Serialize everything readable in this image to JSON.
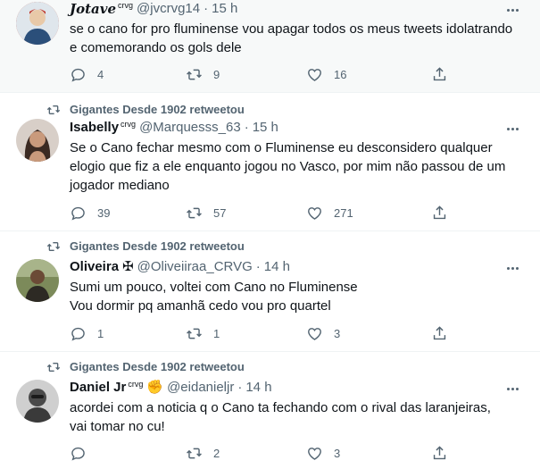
{
  "tweets": [
    {
      "retweeted_by": "",
      "name": "Jotave",
      "name_badge": "crvg",
      "handle": "@jvcrvg14",
      "time": "15 h",
      "text": "se o cano for pro fluminense vou apagar todos os meus tweets idolatrando e comemorando os gols dele",
      "replies": "4",
      "retweets": "9",
      "likes": "16",
      "avatar_colors": [
        "#b33a2c",
        "#e8c9a8"
      ]
    },
    {
      "retweeted_by": "Gigantes Desde 1902 retweetou",
      "name": "Isabelly",
      "name_badge": "crvg",
      "handle": "@Marquesss_63",
      "time": "15 h",
      "text": "Se o Cano fechar mesmo com o Fluminense eu desconsidero qualquer elogio que fiz a ele enquanto jogou no Vasco, por mim não passou de um jogador mediano",
      "replies": "39",
      "retweets": "57",
      "likes": "271",
      "avatar_colors": [
        "#3b2a22",
        "#c99a7c"
      ]
    },
    {
      "retweeted_by": "Gigantes Desde 1902 retweetou",
      "name": "Oliveira",
      "name_badge": "✠",
      "handle": "@Oliveiiraa_CRVG",
      "time": "14 h",
      "text_lines": [
        "Sumi um pouco, voltei com Cano no Fluminense",
        "Vou dormir pq amanhã cedo vou pro quartel"
      ],
      "replies": "1",
      "retweets": "1",
      "likes": "3",
      "avatar_colors": [
        "#4a5238",
        "#2d2a24"
      ]
    },
    {
      "retweeted_by": "Gigantes Desde 1902 retweetou",
      "name": "Daniel Jr",
      "name_badge": "crvg",
      "name_emoji": "✊",
      "handle": "@eidanieljr",
      "time": "14 h",
      "text": "acordei com a noticia q o Cano ta fechando com o rival das laranjeiras, vai tomar no cu!",
      "replies": "",
      "retweets": "2",
      "likes": "3",
      "avatar_colors": [
        "#6d6d6d",
        "#3a3a3a"
      ]
    }
  ],
  "icons": {
    "reply": "reply-icon",
    "retweet": "retweet-icon",
    "like": "heart-icon",
    "share": "share-icon",
    "more": "more-icon"
  },
  "colors": {
    "secondary_text": "#536471",
    "primary_text": "#0f1419",
    "divider": "#eff3f4"
  }
}
